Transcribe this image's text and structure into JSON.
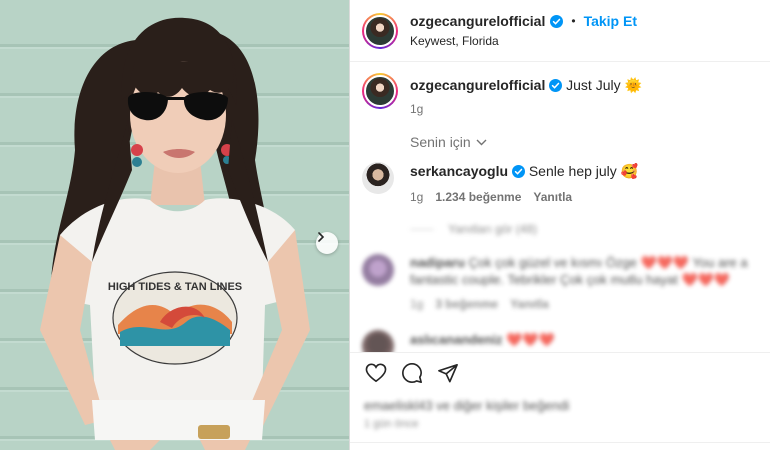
{
  "post": {
    "username": "ozgecangurelofficial",
    "follow_label": "Takip Et",
    "location": "Keywest, Florida",
    "caption": "Just July",
    "caption_emoji": "🌞",
    "caption_age": "1g"
  },
  "photo": {
    "shirt_print": "HIGH TIDES & TAN LINES"
  },
  "comments_sort": "Senin için",
  "comments": [
    {
      "username": "serkancayoglu",
      "text": "Senle hep july",
      "emoji": "🥰",
      "age": "1g",
      "likes": "1.234 beğenme",
      "reply_label": "Yanıtla"
    }
  ],
  "hidden_replies": "Yanıtları gör (48)",
  "blurred_comments": [
    {
      "username": "nadiparu",
      "text": "Çok çok güzel ve kısmı Özge ❤️❤️❤️ You are a fantastic couple. Tebrikler Çok çok mutlu hayat ❤️❤️❤️",
      "age": "1g",
      "likes": "3 beğenme",
      "reply_label": "Yanıtla"
    },
    {
      "username": "aslıcanandeniz",
      "text": "❤️❤️❤️"
    }
  ],
  "liked_by": "emaeliskl43 ve diğer kişiler beğendi",
  "date": "1 gün önce",
  "colors": {
    "accent": "#0095f6",
    "muted": "#737373",
    "verified": "#0095f6"
  },
  "icons": [
    "chevron-right-icon",
    "verified-badge-icon",
    "chevron-down-icon",
    "heart-icon",
    "comment-icon",
    "share-icon"
  ]
}
